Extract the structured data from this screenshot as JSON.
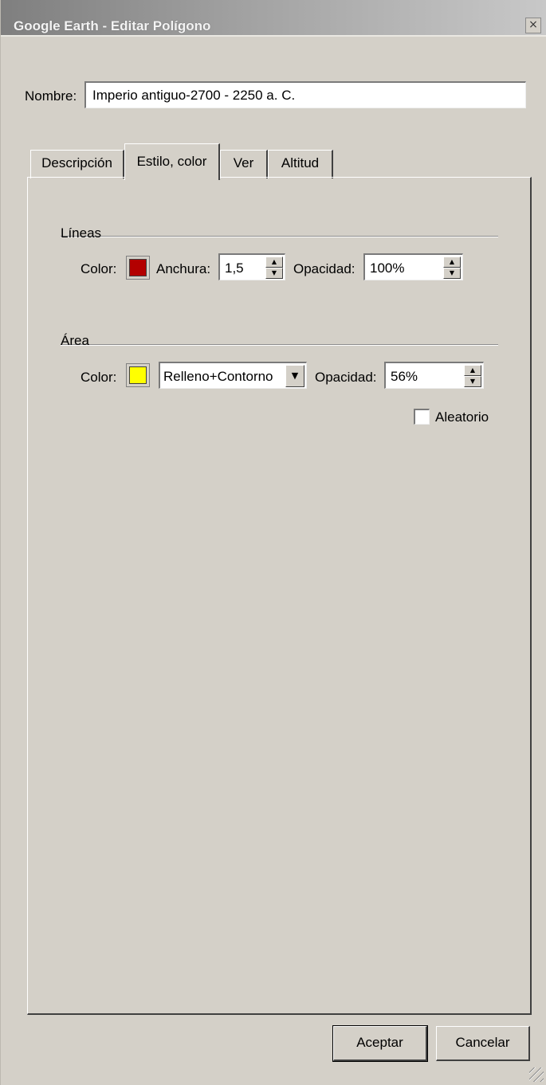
{
  "window": {
    "title": "Google Earth - Editar Polígono",
    "close_glyph": "×"
  },
  "name": {
    "label": "Nombre:",
    "value": "Imperio antiguo-2700 - 2250 a. C."
  },
  "tabs": [
    {
      "label": "Descripción",
      "active": false
    },
    {
      "label": "Estilo, color",
      "active": true
    },
    {
      "label": "Ver",
      "active": false
    },
    {
      "label": "Altitud",
      "active": false
    }
  ],
  "lines": {
    "title": "Líneas",
    "color_label": "Color:",
    "color": "#b30000",
    "width_label": "Anchura:",
    "width_value": "1,5",
    "opacity_label": "Opacidad:",
    "opacity_value": "100%"
  },
  "area": {
    "title": "Área",
    "color_label": "Color:",
    "color": "#ffff00",
    "mode_value": "Relleno+Contorno",
    "opacity_label": "Opacidad:",
    "opacity_value": "56%",
    "random_label": "Aleatorio",
    "random_checked": false
  },
  "buttons": {
    "ok": "Aceptar",
    "cancel": "Cancelar"
  },
  "icons": {
    "spin_up": "▲",
    "spin_down": "▼",
    "dropdown": "▼"
  }
}
